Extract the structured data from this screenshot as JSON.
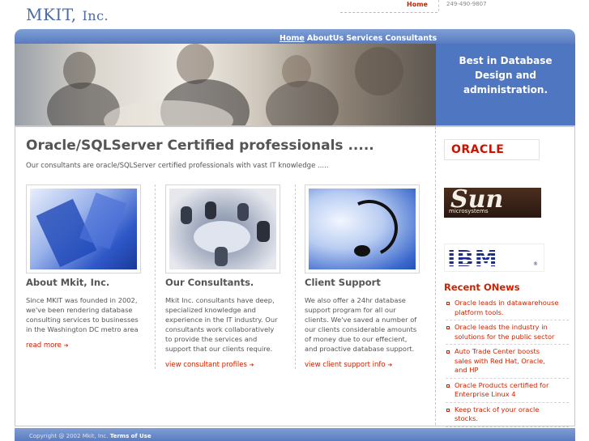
{
  "header": {
    "logo_main": "MKIT, ",
    "logo_small": "Inc.",
    "home_link": "Home",
    "phone": "249-490-9807"
  },
  "nav": {
    "items": [
      "Home",
      "AboutUs",
      "Services",
      "Consultants"
    ]
  },
  "banner": {
    "tagline_line1": "Best in Database",
    "tagline_line2": "Design and",
    "tagline_line3": "administration."
  },
  "main": {
    "title": "Oracle/SQLServer Certified professionals .....",
    "subtitle": "Our consultants are oracle/SQLServer certified professionals  with vast IT knowledge ....."
  },
  "columns": [
    {
      "title": "About Mkit, Inc.",
      "text_lines": [
        "Since MKIT was founded in 2002,",
        "we've been rendering database",
        "consulting services to businesses",
        "in the Washington DC metro area"
      ],
      "link": "read more"
    },
    {
      "title": "Our Consultants.",
      "text_lines": [
        "Mkit Inc. consultants have deep,",
        "specialized knowledge and",
        "experience in the IT industry. Our",
        "consultants  work collaboratively",
        "to provide the services and",
        "support that our clients require."
      ],
      "link": "view consultant profiles"
    },
    {
      "title": "Client Support",
      "text_lines": [
        "We also offer a 24hr database",
        "support program for all our",
        "clients. We've saved a number of",
        "our clients considerable amounts",
        "of money due to our effecient,",
        "and proactive database support."
      ],
      "link": "view client support info"
    }
  ],
  "partners": {
    "oracle": "ORACLE",
    "sun_big": "Sun",
    "sun_small": "microsystems",
    "ibm": "IBM",
    "ibm_reg": "®"
  },
  "news": {
    "title": "Recent ONews",
    "items": [
      [
        "Oracle leads in datawarehouse",
        "platform tools."
      ],
      [
        "Oracle leads the industry in",
        "solutions for the public sector"
      ],
      [
        "Auto Trade Center boosts",
        "sales with Red Hat, Oracle,",
        "and HP"
      ],
      [
        "Oracle Products certified for",
        "Enterprise Linux 4"
      ],
      [
        "Keep track of your oracle",
        "stocks."
      ]
    ]
  },
  "footer": {
    "copyright": "Copyright @ 2002 Mkit, Inc. ",
    "terms": "Terms of Use"
  },
  "colors": {
    "nav_blue": "#5a7cc0",
    "tagline_blue": "#4f76c0",
    "accent_red": "#cc2200",
    "text_gray": "#555555",
    "logo_blue": "#4a6aa8"
  }
}
